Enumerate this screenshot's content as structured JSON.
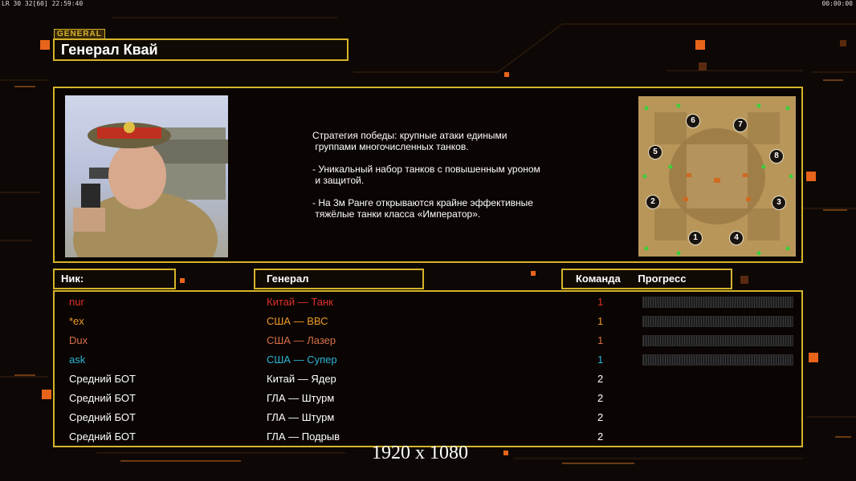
{
  "hud": {
    "left_text": "LR 30 32[60] 22:59:40",
    "right_text": "00:00:00"
  },
  "general_tag": "GENERAL",
  "general_name": "Генерал Квай",
  "description": {
    "line1": "Стратегия победы: крупные атаки едиными\n группами многочисленных танков.",
    "line2": "- Уникальный набор танков с повышенным уроном\n и защитой.",
    "line3": "- На 3м Ранге открываются крайне эффективные\n тяжёлые танки класса «Император»."
  },
  "minimap": {
    "slots": [
      "1",
      "2",
      "3",
      "4",
      "5",
      "6",
      "7",
      "8"
    ]
  },
  "headers": {
    "nick": "Ник:",
    "general": "Генерал",
    "team": "Команда",
    "progress": "Прогресс"
  },
  "players": [
    {
      "nick": "nur",
      "general": "Китай — Танк",
      "team": "1",
      "color": "#e0302a",
      "progress": true
    },
    {
      "nick": "*ex",
      "general": "США — ВВС",
      "team": "1",
      "color": "#f09a2a",
      "progress": true
    },
    {
      "nick": "Dux",
      "general": "США — Лазер",
      "team": "1",
      "color": "#d8704a",
      "progress": true
    },
    {
      "nick": "ask",
      "general": "США — Супер",
      "team": "1",
      "color": "#2ab4d8",
      "progress": true
    },
    {
      "nick": "Средний БОТ",
      "general": "Китай — Ядер",
      "team": "2",
      "color": "#ffffff",
      "progress": false
    },
    {
      "nick": "Средний БОТ",
      "general": "ГЛА — Штурм",
      "team": "2",
      "color": "#ffffff",
      "progress": false
    },
    {
      "nick": "Средний БОТ",
      "general": "ГЛА — Штурм",
      "team": "2",
      "color": "#ffffff",
      "progress": false
    },
    {
      "nick": "Средний БОТ",
      "general": "ГЛА — Подрыв",
      "team": "2",
      "color": "#ffffff",
      "progress": false
    }
  ],
  "resolution_label": "1920 x 1080",
  "colors": {
    "accent": "#d6b42a",
    "background": "#0d0805",
    "decor_orange": "#e8641a"
  }
}
